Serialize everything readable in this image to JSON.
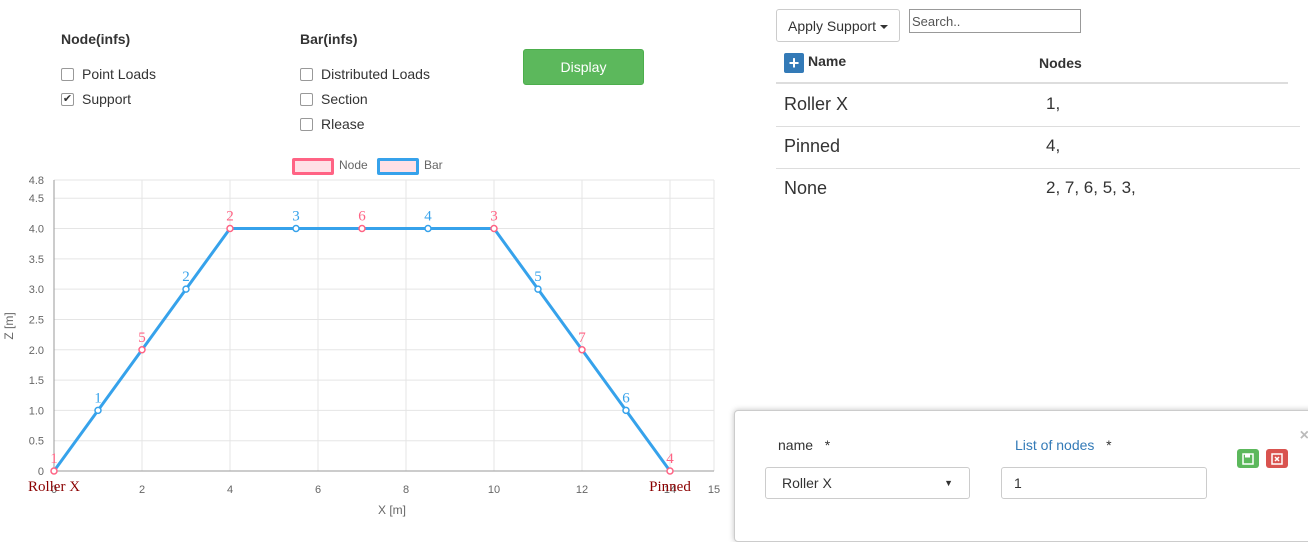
{
  "options": {
    "node_heading": "Node(infs)",
    "bar_heading": "Bar(infs)",
    "node_items": [
      {
        "label": "Point Loads",
        "checked": false
      },
      {
        "label": "Support",
        "checked": true
      }
    ],
    "bar_items": [
      {
        "label": "Distributed Loads",
        "checked": false
      },
      {
        "label": "Section",
        "checked": false
      },
      {
        "label": "Rlease",
        "checked": false
      }
    ],
    "display_button": "Display"
  },
  "toolbar": {
    "apply_support_label": "Apply Support",
    "search_placeholder": "Search.."
  },
  "table": {
    "headers": {
      "name": "Name",
      "nodes": "Nodes"
    },
    "rows": [
      {
        "name": "Roller X",
        "nodes": "1,"
      },
      {
        "name": "Pinned",
        "nodes": "4,"
      },
      {
        "name": "None",
        "nodes": "2, 7, 6, 5, 3,"
      }
    ]
  },
  "modal": {
    "name_label": "name",
    "required_mark": "*",
    "nodes_label": "List of nodes",
    "selected_support": "Roller X",
    "nodes_value": "1",
    "close_symbol": "×"
  },
  "colors": {
    "node": "#ff6384",
    "bar": "#36a2eb",
    "display_button": "#5cb85c",
    "primary": "#337ab7",
    "support_label": "#8b0000"
  },
  "chart_data": {
    "type": "line",
    "legend": [
      "Node",
      "Bar"
    ],
    "legend_position": "top",
    "xlabel": "X [m]",
    "ylabel": "Z [m]",
    "xlim": [
      0,
      15
    ],
    "ylim": [
      0,
      4.8
    ],
    "x_ticks": [
      "0",
      "2",
      "4",
      "6",
      "8",
      "10",
      "12",
      "14",
      "15"
    ],
    "y_ticks": [
      "0",
      "0.5",
      "1.0",
      "1.5",
      "2.0",
      "2.5",
      "3.0",
      "3.5",
      "4.0",
      "4.5",
      "4.8"
    ],
    "grid": true,
    "series": [
      {
        "name": "Node",
        "points": [
          {
            "label": "1",
            "x": 0,
            "y": 0
          },
          {
            "label": "5",
            "x": 2,
            "y": 2
          },
          {
            "label": "2",
            "x": 4,
            "y": 4
          },
          {
            "label": "6",
            "x": 7,
            "y": 4
          },
          {
            "label": "3",
            "x": 10,
            "y": 4
          },
          {
            "label": "7",
            "x": 12,
            "y": 2
          },
          {
            "label": "4",
            "x": 14,
            "y": 0
          }
        ]
      },
      {
        "name": "Bar",
        "points": [
          {
            "label": "1",
            "x": 1,
            "y": 1
          },
          {
            "label": "2",
            "x": 3,
            "y": 3
          },
          {
            "label": "3",
            "x": 5.5,
            "y": 4
          },
          {
            "label": "4",
            "x": 8.5,
            "y": 4
          },
          {
            "label": "5",
            "x": 11,
            "y": 3
          },
          {
            "label": "6",
            "x": 13,
            "y": 1
          }
        ]
      }
    ],
    "outline": [
      [
        0,
        0
      ],
      [
        1,
        1
      ],
      [
        2,
        2
      ],
      [
        3,
        3
      ],
      [
        4,
        4
      ],
      [
        5.5,
        4
      ],
      [
        7,
        4
      ],
      [
        8.5,
        4
      ],
      [
        10,
        4
      ],
      [
        11,
        3
      ],
      [
        12,
        2
      ],
      [
        13,
        1
      ],
      [
        14,
        0
      ]
    ],
    "support_labels": [
      {
        "text": "Roller X",
        "x": 0,
        "y": 0
      },
      {
        "text": "Pinned",
        "x": 14,
        "y": 0
      }
    ]
  }
}
